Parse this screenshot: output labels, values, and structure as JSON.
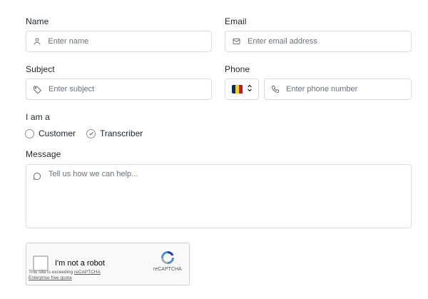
{
  "form": {
    "name": {
      "label": "Name",
      "placeholder": "Enter name",
      "value": ""
    },
    "email": {
      "label": "Email",
      "placeholder": "Enter email address",
      "value": ""
    },
    "subject": {
      "label": "Subject",
      "placeholder": "Enter subject",
      "value": ""
    },
    "phone": {
      "label": "Phone",
      "placeholder": "Enter phone number",
      "value": "",
      "country_flag_colors": [
        "#002b7f",
        "#fcd116",
        "#ce1126"
      ]
    },
    "role": {
      "label": "I am a",
      "options": [
        {
          "label": "Customer",
          "selected": false
        },
        {
          "label": "Transcriber",
          "selected": true
        }
      ]
    },
    "message": {
      "label": "Message",
      "placeholder": "Tell us how we can help...",
      "value": ""
    }
  },
  "recaptcha": {
    "checkbox_label": "I'm not a robot",
    "brand": "reCAPTCHA",
    "note_prefix": "This site is exceeding ",
    "note_link1": "reCAPTCHA",
    "note_link2": "Enterprise free quota"
  },
  "icons": {
    "name": "user-icon",
    "email": "mail-icon",
    "subject": "tag-icon",
    "phone": "phone-icon",
    "message": "chat-bubble-icon",
    "select": "chevron-up-down-icon"
  }
}
